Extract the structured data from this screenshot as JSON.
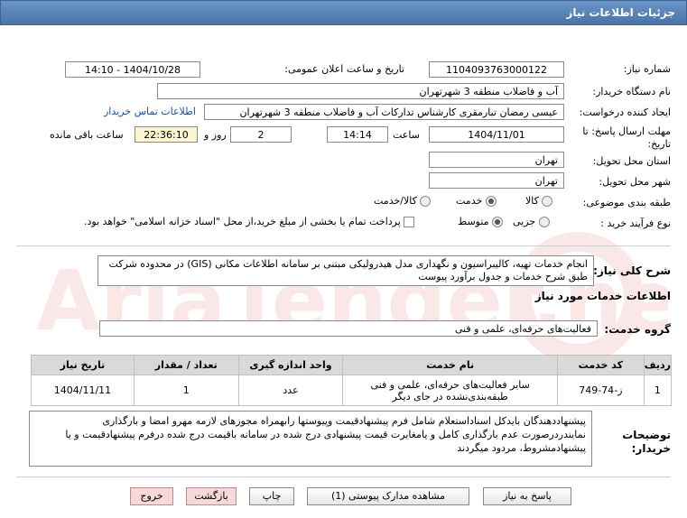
{
  "header": {
    "title": "جزئیات اطلاعات نیاز"
  },
  "fields": {
    "need_number_label": "شماره نیاز:",
    "need_number": "1104093763000122",
    "announce_label": "تاریخ و ساعت اعلان عمومی:",
    "announce_value": "1404/10/28 - 14:10",
    "buyer_label": "نام دستگاه خریدار:",
    "buyer_value": "آب و فاضلاب منطقه 3 شهرتهران",
    "creator_label": "ایجاد کننده درخواست:",
    "creator_value": "عیسی رمضان تبارمقری کارشناس تدارکات  آب و فاضلاب منطقه 3 شهرتهران",
    "contact_link": "اطلاعات تماس خریدار",
    "deadline_label": "مهلت ارسال پاسخ: تا تاریخ:",
    "deadline_date": "1404/11/01",
    "time_label": "ساعت",
    "deadline_time": "14:14",
    "days_value": "2",
    "days_label": "روز و",
    "remaining_time": "22:36:10",
    "remaining_label": "ساعت باقی مانده",
    "province_label": "استان محل تحویل:",
    "province_value": "تهران",
    "city_label": "شهر محل تحویل:",
    "city_value": "تهران",
    "category_label": "طبقه بندی موضوعی:",
    "category_options": [
      "کالا",
      "خدمت",
      "کالا/خدمت"
    ],
    "category_selected": "خدمت",
    "purchase_label": "نوع فرآیند خرید :",
    "purchase_options": [
      "جزیی",
      "متوسط"
    ],
    "purchase_selected": "متوسط",
    "payment_note": "پرداخت تمام یا بخشی از مبلغ خرید،از محل \"اسناد خزانه اسلامی\" خواهد بود."
  },
  "summary": {
    "label": "شرح کلی نیاز:",
    "text": "انجام خدمات تهیه، کالیبراسیون و نگهداری مدل هیدرولیکی مبتنی بر سامانه اطلاعات مکانی (GIS) در محدوده شرکت طبق شرح خدمات و جدول برآورد پیوست"
  },
  "services": {
    "title": "اطلاعات خدمات مورد نیاز",
    "group_label": "گروه خدمت:",
    "group_value": "فعالیت‌های حرفه‌ای، علمی و فنی",
    "columns": [
      "ردیف",
      "کد خدمت",
      "نام خدمت",
      "واحد اندازه گیری",
      "تعداد / مقدار",
      "تاریخ نیاز"
    ],
    "rows": [
      {
        "row": "1",
        "code": "ز-74-749",
        "name": "سایر فعالیت‌های حرفه‌ای، علمی و فنی طبقه‌بندی‌نشده در جای دیگر",
        "unit": "عدد",
        "qty": "1",
        "date": "1404/11/11"
      }
    ]
  },
  "buyer_notes": {
    "label": "توضیحات خریدار:",
    "text": "پیشنهاددهندگان بایدکل اسناداستعلام شامل فرم پیشنهادقیمت وپیوستها رابهمراه مجوزهای لازمه مهرو امضا و بارگذاری نمایندردرصورت عدم بارگذاری کامل و یامغایرت قیمت پیشنهادی درج شده در سامانه باقیمت درج شده درفرم پیشنهادقیمت و یا پیشنهادمشروط، مردود میگردند"
  },
  "buttons": {
    "reply": "پاسخ به نیاز",
    "docs": "مشاهده مدارک پیوستی (1)",
    "print": "چاپ",
    "back": "بازگشت",
    "exit": "خروج"
  },
  "watermark": {
    "text": "AriaTender.net"
  }
}
